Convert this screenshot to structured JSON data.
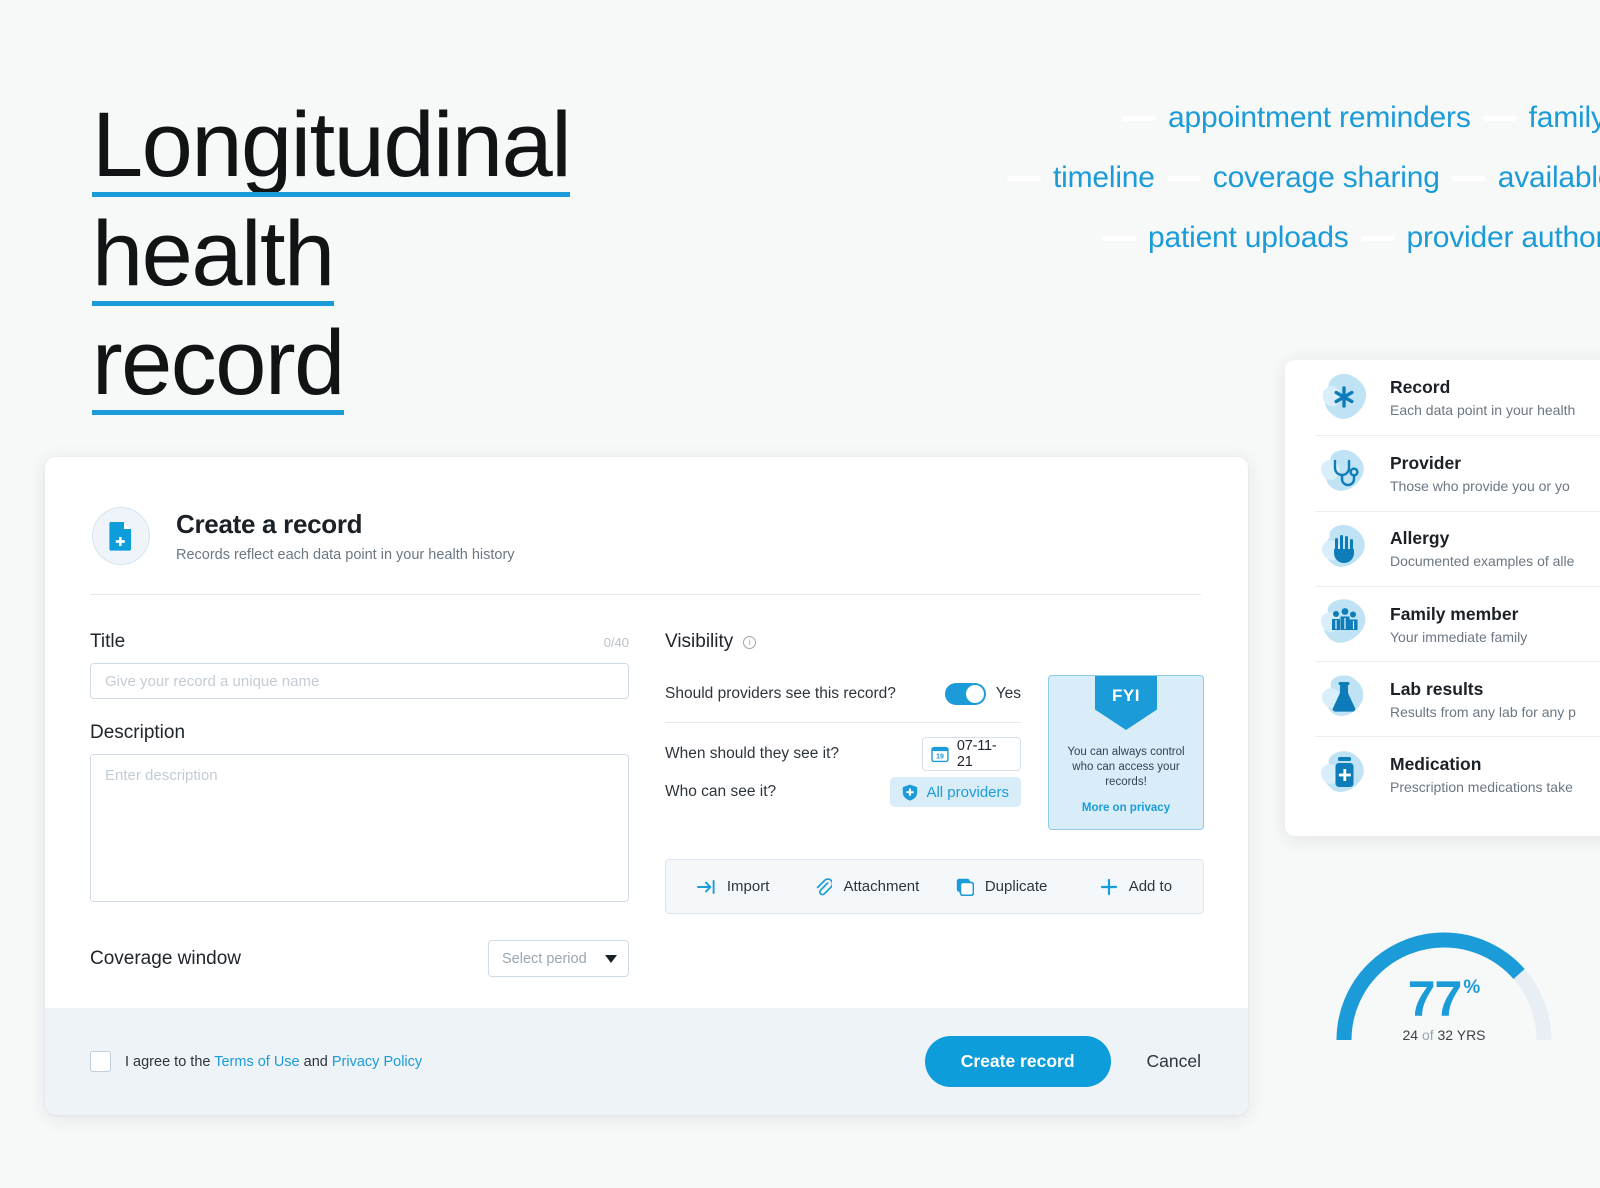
{
  "hero": {
    "lines": [
      "Longitudinal",
      "health",
      "record"
    ],
    "underline_color": "#1b9bd8"
  },
  "tag_cloud": {
    "rows": [
      [
        "appointment reminders",
        "family"
      ],
      [
        "timeline",
        "coverage sharing",
        "available"
      ],
      [
        "patient uploads",
        "provider author"
      ]
    ],
    "color": "#1b9bd8"
  },
  "card": {
    "icon": "document-plus-icon",
    "title": "Create a record",
    "subtitle": "Records reflect each data point in your health history"
  },
  "form": {
    "title": {
      "label": "Title",
      "counter": "0/40",
      "placeholder": "Give your record a unique name",
      "value": ""
    },
    "description": {
      "label": "Description",
      "placeholder": "Enter description",
      "value": ""
    },
    "coverage": {
      "label": "Coverage window",
      "select_value": "Select period"
    }
  },
  "visibility": {
    "title": "Visibility",
    "info_icon": "info-icon",
    "rows": [
      {
        "label": "Should providers see this record?",
        "toggle_state": "Yes"
      },
      {
        "label": "When should they see it?",
        "date": "07-11-21",
        "calendar_day": "19"
      },
      {
        "label": "Who can see it?",
        "chip": "All providers"
      }
    ]
  },
  "fyi": {
    "banner": "FYI",
    "text": "You can always control who can access your records!",
    "link": "More on privacy"
  },
  "actions": [
    {
      "icon": "import-icon",
      "label": "Import"
    },
    {
      "icon": "paperclip-icon",
      "label": "Attachment"
    },
    {
      "icon": "duplicate-icon",
      "label": "Duplicate"
    },
    {
      "icon": "plus-icon",
      "label": "Add to"
    }
  ],
  "footer": {
    "agree_prefix": "I agree to the ",
    "terms_link": "Terms of Use",
    "agree_middle": " and ",
    "privacy_link": "Privacy Policy",
    "create_label": "Create record",
    "cancel_label": "Cancel",
    "primary_color": "#0d9ddb"
  },
  "legend": {
    "items": [
      {
        "icon": "asterisk-icon",
        "title": "Record",
        "desc": "Each data point in your health"
      },
      {
        "icon": "stethoscope-icon",
        "title": "Provider",
        "desc": "Those who provide you or yo"
      },
      {
        "icon": "hand-icon",
        "title": "Allergy",
        "desc": "Documented examples of alle"
      },
      {
        "icon": "family-icon",
        "title": "Family member",
        "desc": "Your immediate family"
      },
      {
        "icon": "flask-icon",
        "title": "Lab results",
        "desc": "Results from any lab for any p"
      },
      {
        "icon": "medication-icon",
        "title": "Medication",
        "desc": "Prescription medications take"
      }
    ]
  },
  "gauge": {
    "percent": "77",
    "percent_sign": "%",
    "sub_value": "24",
    "sub_of": "of",
    "sub_total": "32",
    "sub_unit": "YRS",
    "fill_color": "#1b9bd8",
    "track_color": "#e8eef3",
    "value": 77
  }
}
